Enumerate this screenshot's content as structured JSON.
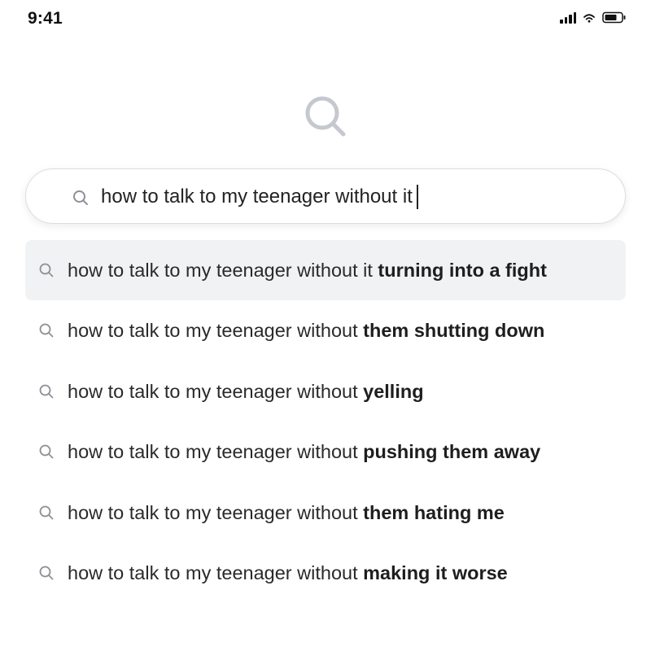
{
  "status_bar": {
    "time": "9:41",
    "icons": [
      "cellular-signal-icon",
      "wifi-icon",
      "battery-icon"
    ]
  },
  "hero": {
    "icon": "search-icon"
  },
  "search": {
    "value": "how to talk to my teenager without it",
    "icon": "search-icon"
  },
  "suggestions": [
    {
      "prefix": "how to talk to my teenager without it ",
      "completion": "turning into a fight",
      "highlighted": true
    },
    {
      "prefix": "how to talk to my teenager without ",
      "completion": "them shutting down",
      "highlighted": false
    },
    {
      "prefix": "how to talk to my teenager without ",
      "completion": "yelling",
      "highlighted": false
    },
    {
      "prefix": "how to talk to my teenager without ",
      "completion": "pushing them away",
      "highlighted": false
    },
    {
      "prefix": "how to talk to my teenager without ",
      "completion": "them hating me",
      "highlighted": false
    },
    {
      "prefix": "how to talk to my teenager without ",
      "completion": "making it worse",
      "highlighted": false
    }
  ],
  "colors": {
    "highlight_row": "#f1f2f4",
    "icon_gray": "#8e9096",
    "hero_icon": "#c5c8ce",
    "text": "#222222"
  }
}
